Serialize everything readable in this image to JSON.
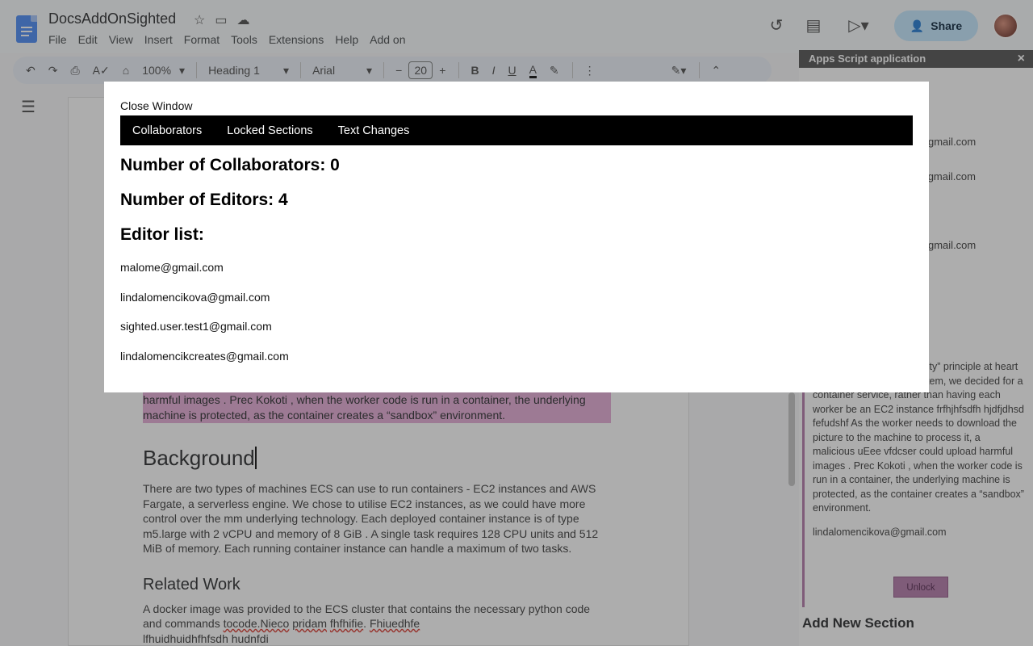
{
  "app": {
    "title": "DocsAddOnSighted",
    "menu": [
      "File",
      "Edit",
      "View",
      "Insert",
      "Format",
      "Tools",
      "Extensions",
      "Help",
      "Add on"
    ],
    "share_label": "Share"
  },
  "toolbar": {
    "zoom": "100%",
    "style": "Heading 1",
    "font": "Arial",
    "font_size": "20"
  },
  "document": {
    "highlighted_text": "harmful images . Prec Kokoti , when the worker code is run in a container, the underlying machine is protected, as the container creates a “sandbox” environment.",
    "heading1": "Background",
    "para1": "There are two types of machines ECS can use to run containers - EC2 instances and AWS Fargate, a serverless engine. We chose to utilise EC2 instances, as we could have more control over the mm underlying technology. Each deployed container instance is of type m5.large with 2 vCPU and memory of 8 GiB . A single task requires 128 CPU units and 512 MiB of memory. Each running container instance can handle a maximum of two tasks.",
    "heading2": "Related Work",
    "para2_a": "A docker image was provided to the ECS cluster that contains the necessary python code and commands ",
    "para2_sq1": "tocode.Nieco",
    "para2_sq2": "pridam",
    "para2_sq3": "fhfhifie",
    "para2_b": ". ",
    "para2_sq4": "Fhiuedhfe",
    "para2_c": "lfhuidhuidhfhfsdh hudnfdi"
  },
  "sidebar": {
    "title": "Apps Script application",
    "close": "×",
    "emails_partial": [
      "gmail.com",
      "s@gmail.com",
      "gmail.com"
    ],
    "section_text": "s takes place in an “security” principle at heart when architecting our system, we decided for a container service, rather than having each worker be an EC2 instance frfhjhfsdfh hjdfjdhsd fefudshf As the worker needs to download the picture to the machine to process it, a malicious uEee vfdcser could upload harmful images . Prec Kokoti , when the worker code is run in a container, the underlying machine is protected, as the container creates a “sandbox” environment.",
    "section_user": "lindalomencikova@gmail.com",
    "unlock_label": "Unlock",
    "add_section_label": "Add New Section"
  },
  "modal": {
    "close_label": "Close Window",
    "tabs": [
      "Collaborators",
      "Locked Sections",
      "Text Changes"
    ],
    "collaborators_heading": "Number of Collaborators: 0",
    "editors_heading": "Number of Editors: 4",
    "editor_list_heading": "Editor list:",
    "editors": [
      "malome@gmail.com",
      "lindalomencikova@gmail.com",
      "sighted.user.test1@gmail.com",
      "lindalomencikcreates@gmail.com"
    ]
  }
}
